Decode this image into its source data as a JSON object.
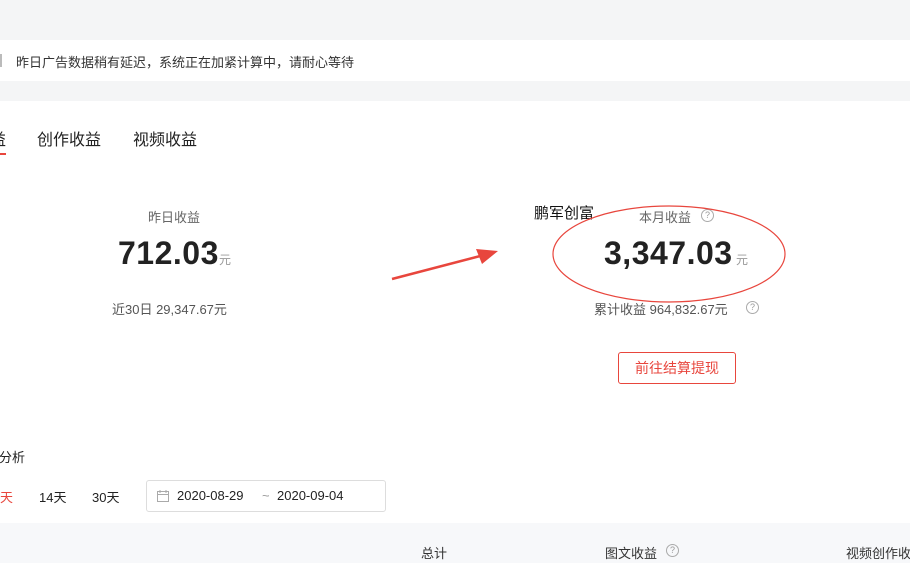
{
  "notice": {
    "text": "昨日广告数据稍有延迟，系统正在加紧计算中，请耐心等待"
  },
  "tabs": [
    {
      "label": "益",
      "active": true
    },
    {
      "label": "创作收益",
      "active": false
    },
    {
      "label": "视频收益",
      "active": false
    }
  ],
  "yesterday": {
    "label": "昨日收益",
    "value": "712.03",
    "unit": "元",
    "last30": "近30日 29,347.67元"
  },
  "month": {
    "label": "本月收益",
    "value": "3,347.03",
    "unit": "元",
    "cumulative": "累计收益 964,832.67元"
  },
  "watermark": "鹏军创富",
  "withdraw_button": "前往结算提现",
  "analysis": {
    "title": "分析",
    "periods": [
      {
        "label": "天",
        "active": true
      },
      {
        "label": "14天",
        "active": false
      },
      {
        "label": "30天",
        "active": false
      }
    ],
    "date_start": "2020-08-29",
    "date_sep": "~",
    "date_end": "2020-09-04"
  },
  "table_headers": [
    "总计",
    "图文收益",
    "视频创作收"
  ],
  "help_glyph": "?",
  "colors": {
    "accent": "#e8463d",
    "annotation": "#e8463d"
  }
}
